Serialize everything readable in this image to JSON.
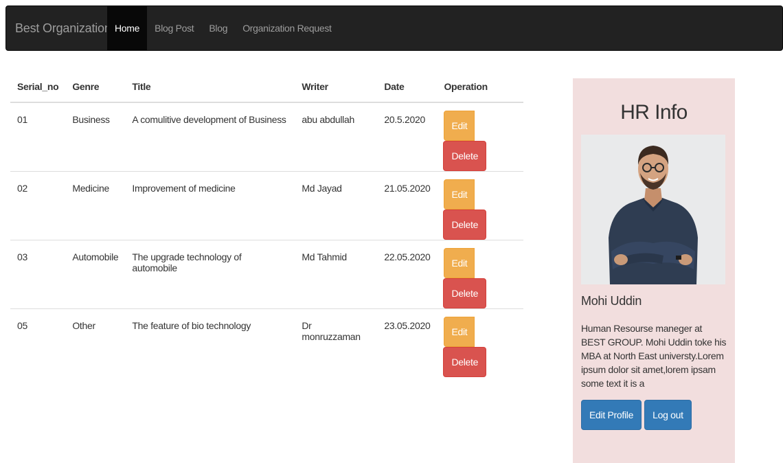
{
  "navbar": {
    "brand": "Best Organization",
    "links": [
      {
        "label": "Home",
        "active": true
      },
      {
        "label": "Blog Post",
        "active": false
      },
      {
        "label": "Blog",
        "active": false
      },
      {
        "label": "Organization Request",
        "active": false
      }
    ]
  },
  "table": {
    "headers": [
      "Serial_no",
      "Genre",
      "Title",
      "Writer",
      "Date",
      "Operation"
    ],
    "edit_label": "Edit",
    "delete_label": "Delete",
    "rows": [
      {
        "serial": "01",
        "genre": "Business",
        "title": "A comulitive development of Business",
        "writer": "abu abdullah",
        "date": "20.5.2020"
      },
      {
        "serial": "02",
        "genre": "Medicine",
        "title": "Improvement of medicine",
        "writer": "Md Jayad",
        "date": "21.05.2020"
      },
      {
        "serial": "03",
        "genre": "Automobile",
        "title": "The upgrade technology of automobile",
        "writer": "Md Tahmid",
        "date": "22.05.2020"
      },
      {
        "serial": "05",
        "genre": "Other",
        "title": "The feature of bio technology",
        "writer": "Dr monruzzaman",
        "date": "23.05.2020"
      }
    ]
  },
  "hr": {
    "title": "HR Info",
    "name": "Mohi Uddin",
    "description": "Human Resourse maneger at BEST GROUP. Mohi Uddin toke his MBA at North East universty.Lorem ipsum dolor sit amet,lorem ipsam some text it is a",
    "edit_profile_label": "Edit Profile",
    "logout_label": "Log out"
  },
  "colors": {
    "navbar_bg": "#222222",
    "edit_button": "#f0ad4e",
    "delete_button": "#d9534f",
    "primary_button": "#337ab7",
    "panel_bg": "#f2dede"
  }
}
